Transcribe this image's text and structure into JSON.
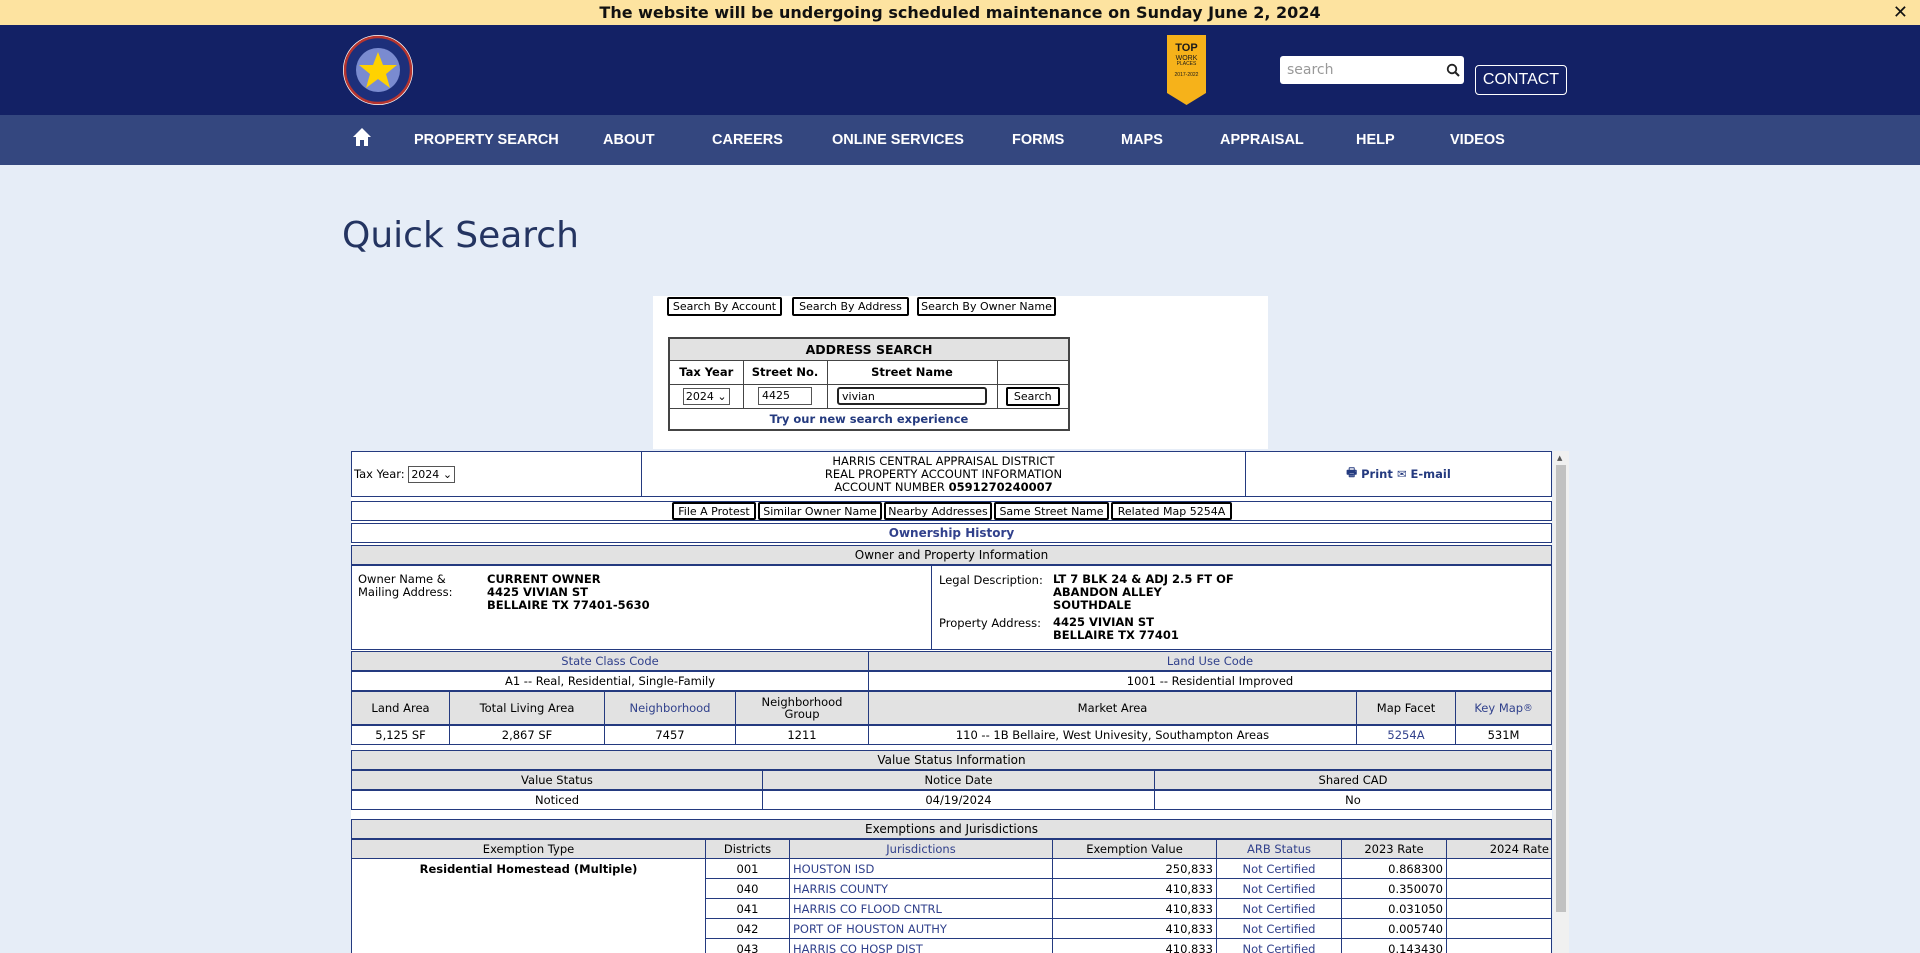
{
  "banner": {
    "text": "The website will be undergoing scheduled maintenance on Sunday June 2, 2024"
  },
  "header": {
    "search_placeholder": "search",
    "contact": "CONTACT",
    "award": {
      "top": "TOP",
      "work": "WORK",
      "places": "PLACES",
      "years": "2017-2022"
    }
  },
  "nav": [
    "PROPERTY SEARCH",
    "ABOUT",
    "CAREERS",
    "ONLINE SERVICES",
    "FORMS",
    "MAPS",
    "APPRAISAL",
    "HELP",
    "VIDEOS"
  ],
  "page_title": "Quick Search",
  "quick": {
    "btn_account": "Search By Account",
    "btn_address": "Search By Address",
    "btn_owner": "Search By Owner Name",
    "heading": "ADDRESS SEARCH",
    "col_year": "Tax Year",
    "col_no": "Street No.",
    "col_name": "Street Name",
    "year": "2024",
    "street_no": "4425",
    "street_name": "vivian",
    "search": "Search",
    "try": "Try our new search experience"
  },
  "acct": {
    "tax_year_label": "Tax Year:",
    "tax_year": "2024",
    "l1": "HARRIS CENTRAL APPRAISAL DISTRICT",
    "l2": "REAL PROPERTY ACCOUNT INFORMATION",
    "l3": "ACCOUNT NUMBER",
    "number": "0591270240007",
    "print": "Print",
    "email": "E-mail"
  },
  "tools": [
    "File A Protest",
    "Similar Owner Name",
    "Nearby Addresses",
    "Same Street Name",
    "Related Map 5254A"
  ],
  "ownership_history": "Ownership History",
  "owner": {
    "section": "Owner and Property Information",
    "label1": "Owner Name &",
    "label2": "Mailing Address:",
    "name": "CURRENT OWNER",
    "addr1": "4425 VIVIAN ST",
    "addr2": "BELLAIRE TX 77401-5630",
    "legal_label": "Legal Description:",
    "legal1": "LT 7 BLK 24 & ADJ 2.5 FT OF",
    "legal2": "ABANDON ALLEY",
    "legal3": "SOUTHDALE",
    "prop_label": "Property Address:",
    "prop1": "4425 VIVIAN ST",
    "prop2": "BELLAIRE TX 77401"
  },
  "class": {
    "state_label": "State Class Code",
    "land_label": "Land Use Code",
    "state_val": "A1 -- Real, Residential, Single-Family",
    "land_val": "1001 -- Residential Improved"
  },
  "area": {
    "h": [
      "Land Area",
      "Total Living Area",
      "Neighborhood",
      "Neighborhood",
      "Group",
      "Market Area",
      "Map Facet",
      "Key Map",
      "®"
    ],
    "v": [
      "5,125 SF",
      "2,867 SF",
      "7457",
      "1211",
      "110 -- 1B Bellaire, West Univesity, Southampton Areas",
      "5254A",
      "531M"
    ]
  },
  "value_status": {
    "section": "Value Status Information",
    "h": [
      "Value Status",
      "Notice Date",
      "Shared CAD"
    ],
    "v": [
      "Noticed",
      "04/19/2024",
      "No"
    ]
  },
  "ex": {
    "section": "Exemptions and Jurisdictions",
    "h": [
      "Exemption Type",
      "Districts",
      "Jurisdictions",
      "Exemption Value",
      "ARB Status",
      "2023 Rate",
      "2024 Rate"
    ],
    "type": "Residential Homestead (Multiple)",
    "rows": [
      [
        "001",
        "HOUSTON ISD",
        "250,833",
        "Not Certified",
        "0.868300"
      ],
      [
        "040",
        "HARRIS COUNTY",
        "410,833",
        "Not Certified",
        "0.350070"
      ],
      [
        "041",
        "HARRIS CO FLOOD CNTRL",
        "410,833",
        "Not Certified",
        "0.031050"
      ],
      [
        "042",
        "PORT OF HOUSTON AUTHY",
        "410,833",
        "Not Certified",
        "0.005740"
      ],
      [
        "043",
        "HARRIS CO HOSP DIST",
        "410,833",
        "Not Certified",
        "0.143430"
      ]
    ]
  }
}
